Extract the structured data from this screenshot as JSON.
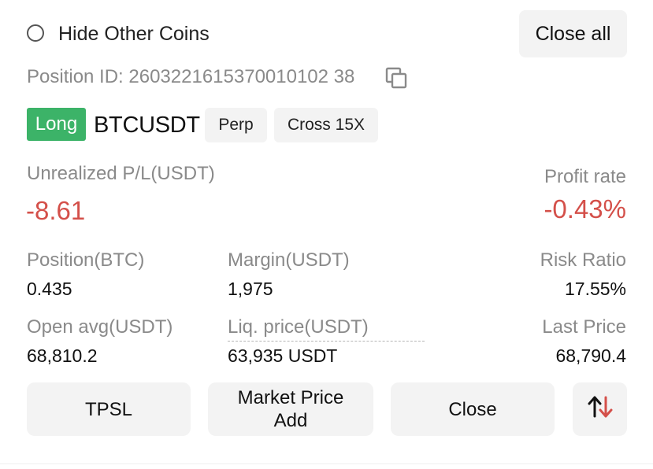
{
  "header": {
    "hide_other_coins_label": "Hide Other Coins",
    "close_all_label": "Close all"
  },
  "position": {
    "id_label": "Position ID:",
    "id_value": "2603221615370010102 38",
    "side": "Long",
    "symbol": "BTCUSDT",
    "type_tag": "Perp",
    "margin_tag": "Cross 15X"
  },
  "pnl": {
    "unrealized_label": "Unrealized P/L(USDT)",
    "unrealized_value": "-8.61",
    "profit_rate_label": "Profit rate",
    "profit_rate_value": "-0.43%"
  },
  "stats": {
    "position_label": "Position(BTC)",
    "position_value": "0.435",
    "margin_label": "Margin(USDT)",
    "margin_value": "1,975",
    "risk_label": "Risk Ratio",
    "risk_value": "17.55%",
    "open_avg_label": "Open avg(USDT)",
    "open_avg_value": "68,810.2",
    "liq_label": "Liq. price(USDT)",
    "liq_value": "63,935 USDT",
    "last_price_label": "Last Price",
    "last_price_value": "68,790.4"
  },
  "actions": {
    "tpsl_label": "TPSL",
    "market_add_line1": "Market Price",
    "market_add_line2": "Add",
    "close_label": "Close",
    "reverse_icon": "reverse-arrows-icon"
  },
  "colors": {
    "long_green": "#3cb368",
    "loss_red": "#d4504a",
    "label_gray": "#8a8a8a",
    "button_bg": "#f3f3f3"
  }
}
